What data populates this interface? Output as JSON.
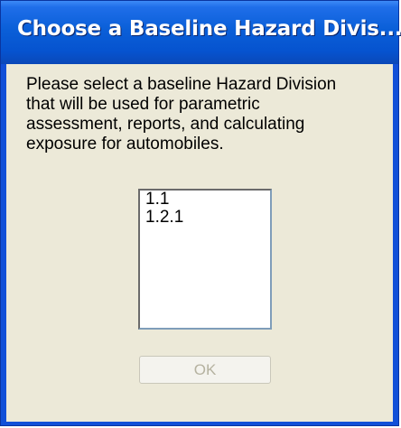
{
  "window": {
    "title": "Choose a Baseline Hazard Divis..."
  },
  "message": {
    "lines": [
      "Please select a baseline Hazard Division",
      "that will be used for parametric",
      "assessment, reports, and calculating",
      "exposure for automobiles."
    ]
  },
  "list": {
    "items": [
      "1.1",
      "1.2.1"
    ]
  },
  "buttons": {
    "ok_label": "OK",
    "ok_enabled": false
  },
  "colors": {
    "title_bar": "#0a5fd8",
    "dialog_face": "#ece9d8",
    "disabled_text": "#b5b2a0"
  }
}
